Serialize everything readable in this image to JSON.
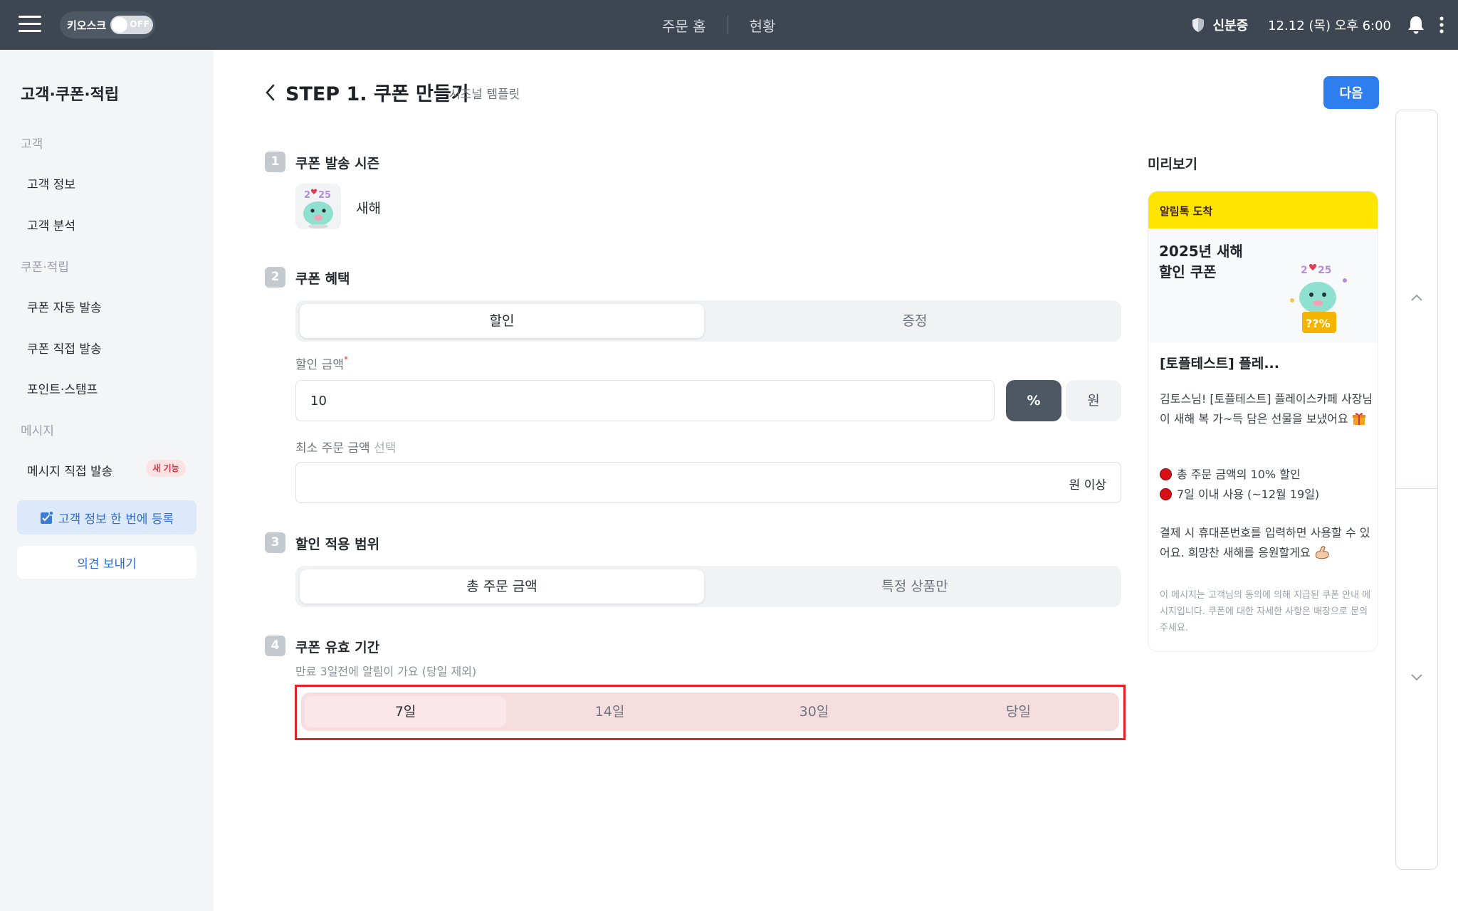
{
  "topbar": {
    "kiosk_label": "키오스크",
    "kiosk_toggle": "OFF",
    "nav": [
      "주문 홈",
      "현황"
    ],
    "verify_label": "신분증",
    "datetime": "12.12 (목) 오후 6:00"
  },
  "sidebar": {
    "title": "고객·쿠폰·적립",
    "groups": [
      {
        "label": "고객",
        "items": [
          "고객 정보",
          "고객 분석"
        ]
      },
      {
        "label": "쿠폰·적립",
        "items": [
          "쿠폰 자동 발송",
          "쿠폰 직접 발송",
          "포인트·스탬프"
        ]
      },
      {
        "label": "메시지",
        "items": [
          "메시지 직접 발송"
        ]
      }
    ],
    "new_badge": "새 기능",
    "register_label": "고객 정보 한 번에 등록",
    "feedback_label": "의견 보내기"
  },
  "header": {
    "title": "STEP 1. 쿠폰 만들기",
    "subtitle": "시즈널 템플릿",
    "next_label": "다음"
  },
  "steps": [
    {
      "num": "1",
      "title": "쿠폰 발송 시즌"
    },
    {
      "num": "2",
      "title": "쿠폰 혜택"
    },
    {
      "num": "3",
      "title": "할인 적용 범위"
    },
    {
      "num": "4",
      "title": "쿠폰 유효 기간"
    }
  ],
  "season": {
    "label": "새해"
  },
  "benefit": {
    "tabs": [
      "할인",
      "증정"
    ],
    "selected": "할인",
    "amount_label": "할인 금액",
    "required_mark": "*",
    "amount_value": "10",
    "units": [
      "%",
      "원"
    ],
    "selected_unit": "%",
    "min_label": "최소 주문 금액",
    "min_optional": "선택",
    "min_value": "",
    "min_suffix": "원 이상"
  },
  "scope": {
    "tabs": [
      "총 주문 금액",
      "특정 상품만"
    ],
    "selected": "총 주문 금액"
  },
  "validity": {
    "hint": "만료 3일전에 알림이 가요 (당일 제외)",
    "options": [
      "7일",
      "14일",
      "30일",
      "당일"
    ],
    "selected": "7일"
  },
  "preview": {
    "title": "미리보기",
    "header": "알림톡 도착",
    "hero_title": "2025년 새해\n할인 쿠폰",
    "badge_text": "??%",
    "store": "[토플테스트] 플레...",
    "greeting": "김토스님! [토플테스트] 플레이스카페 사장님이 새해 복 가~득 담은 선물을 보냈어요",
    "bullet1": "총 주문 금액의 10% 할인",
    "bullet2": "7일 이내 사용 (~12월 19일)",
    "body": "결제 시 휴대폰번호를 입력하면 사용할 수 있어요. 희망찬 새해를 응원할게요",
    "fineprint": "이 메시지는 고객님의 동의에 의해 지급된 쿠폰 안내 메시지입니다. 쿠폰에 대한 자세한 사항은 매장으로 문의주세요."
  },
  "colors": {
    "topbar": "#3d4651",
    "primary": "#2f7ef0",
    "kakao_yellow": "#fee500",
    "highlight_red": "#e02424"
  }
}
